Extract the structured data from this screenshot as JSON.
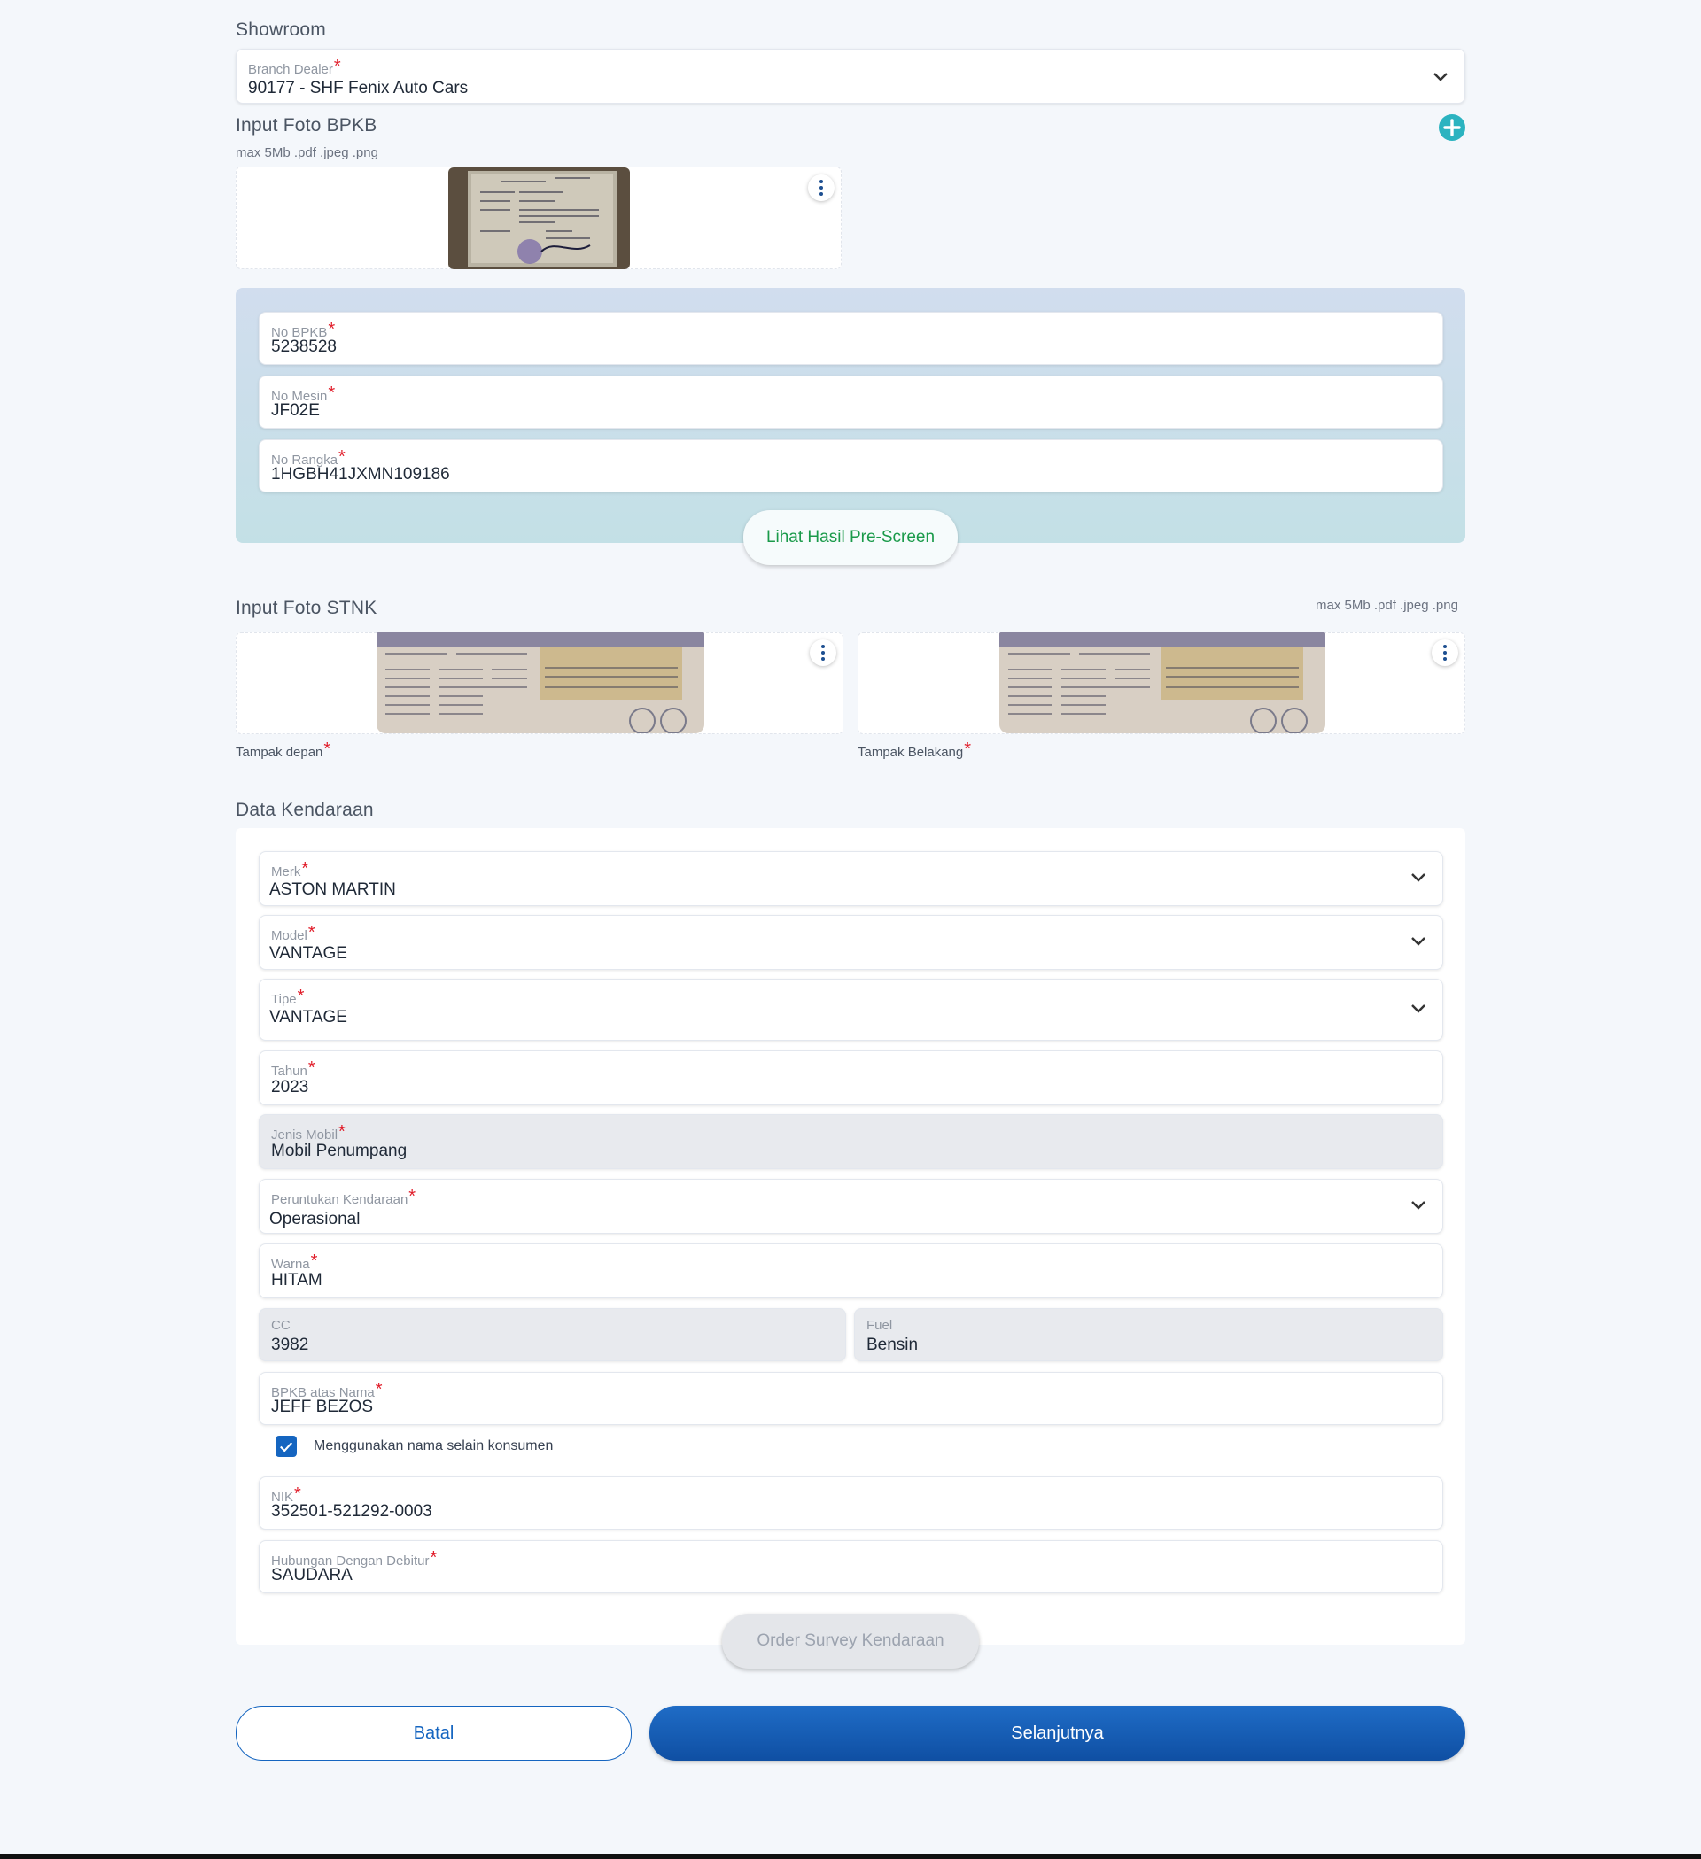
{
  "showroom": {
    "title": "Showroom",
    "branch_label": "Branch Dealer",
    "branch_value": "90177 - SHF Fenix Auto Cars"
  },
  "bpkb_photo": {
    "title": "Input Foto BPKB",
    "hint": "max 5Mb .pdf .jpeg .png"
  },
  "bpkb_fields": {
    "no_bpkb_label": "No BPKB",
    "no_bpkb_value": "5238528",
    "no_mesin_label": "No Mesin",
    "no_mesin_value": "JF02E",
    "no_rangka_label": "No Rangka",
    "no_rangka_value": "1HGBH41JXMN109186",
    "prescreen_button": "Lihat Hasil Pre-Screen"
  },
  "stnk_photo": {
    "title": "Input Foto STNK",
    "hint": "max 5Mb .pdf .jpeg .png",
    "front_label": "Tampak depan",
    "back_label": "Tampak Belakang"
  },
  "kendaraan": {
    "title": "Data Kendaraan",
    "merk_label": "Merk",
    "merk_value": "ASTON MARTIN",
    "model_label": "Model",
    "model_value": "VANTAGE",
    "tipe_label": "Tipe",
    "tipe_value": "VANTAGE",
    "tahun_label": "Tahun",
    "tahun_value": "2023",
    "jenis_label": "Jenis Mobil",
    "jenis_value": "Mobil Penumpang",
    "peruntukan_label": "Peruntukan Kendaraan",
    "peruntukan_value": "Operasional",
    "warna_label": "Warna",
    "warna_value": "HITAM",
    "cc_label": "CC",
    "cc_value": "3982",
    "fuel_label": "Fuel",
    "fuel_value": "Bensin",
    "atas_nama_label": "BPKB atas Nama",
    "atas_nama_value": "JEFF BEZOS",
    "checkbox_label": "Menggunakan nama selain konsumen",
    "checkbox_checked": true,
    "nik_label": "NIK",
    "nik_value": "352501-521292-0003",
    "hubungan_label": "Hubungan Dengan Debitur",
    "hubungan_value": "SAUDARA",
    "survey_button": "Order Survey Kendaraan"
  },
  "footer": {
    "cancel_label": "Batal",
    "next_label": "Selanjutnya"
  },
  "required_mark": "*",
  "colors": {
    "primary": "#1565c0",
    "accent_teal": "#2bb3c0",
    "required": "#e11d2a",
    "prescreen_text": "#1a9a4a"
  },
  "icons": [
    "plus-circle-icon",
    "kebab-menu-icon",
    "chevron-down-icon",
    "check-icon"
  ]
}
